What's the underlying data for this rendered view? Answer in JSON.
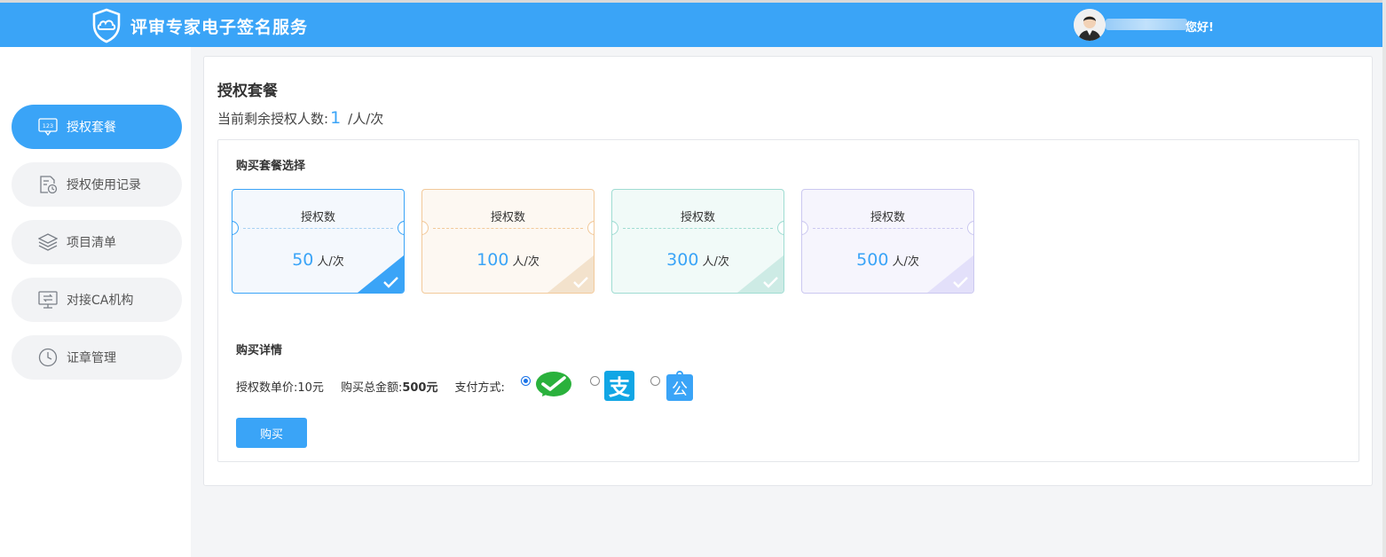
{
  "header": {
    "app_title": "评审专家电子签名服务",
    "greeting": "您好!"
  },
  "sidebar": {
    "items": [
      {
        "label": "授权套餐",
        "icon": "license-123-icon",
        "active": true
      },
      {
        "label": "授权使用记录",
        "icon": "record-clock-icon",
        "active": false
      },
      {
        "label": "项目清单",
        "icon": "layers-icon",
        "active": false
      },
      {
        "label": "对接CA机构",
        "icon": "monitor-exchange-icon",
        "active": false
      },
      {
        "label": "证章管理",
        "icon": "clock-icon",
        "active": false
      }
    ]
  },
  "main": {
    "title": "授权套餐",
    "remain_label": "当前剩余授权人数:",
    "remain_value": "1",
    "remain_unit": "/人/次",
    "package_section_title": "购买套餐选择",
    "packages": [
      {
        "label": "授权数",
        "value": "50",
        "unit": "人/次",
        "selected": true,
        "color": "#3aa4f7"
      },
      {
        "label": "授权数",
        "value": "100",
        "unit": "人/次",
        "selected": false,
        "color": "#f2c99a"
      },
      {
        "label": "授权数",
        "value": "300",
        "unit": "人/次",
        "selected": false,
        "color": "#9fdcd2"
      },
      {
        "label": "授权数",
        "value": "500",
        "unit": "人/次",
        "selected": false,
        "color": "#cbc8f0"
      }
    ],
    "detail_section_title": "购买详情",
    "unit_price_label": "授权数单价:",
    "unit_price_value": "10元",
    "total_label": "购买总金额:",
    "total_value": "500元",
    "payment_label": "支付方式:",
    "payment_methods": [
      {
        "name": "wechat-pay-icon",
        "checked": true
      },
      {
        "name": "alipay-icon",
        "checked": false
      },
      {
        "name": "corporate-pay-icon",
        "checked": false
      }
    ],
    "buy_button": "购买"
  },
  "colors": {
    "accent": "#3aa4f7",
    "wechat": "#2ab13c",
    "alipay": "#11a6e5",
    "corporate": "#3aa4f7"
  }
}
